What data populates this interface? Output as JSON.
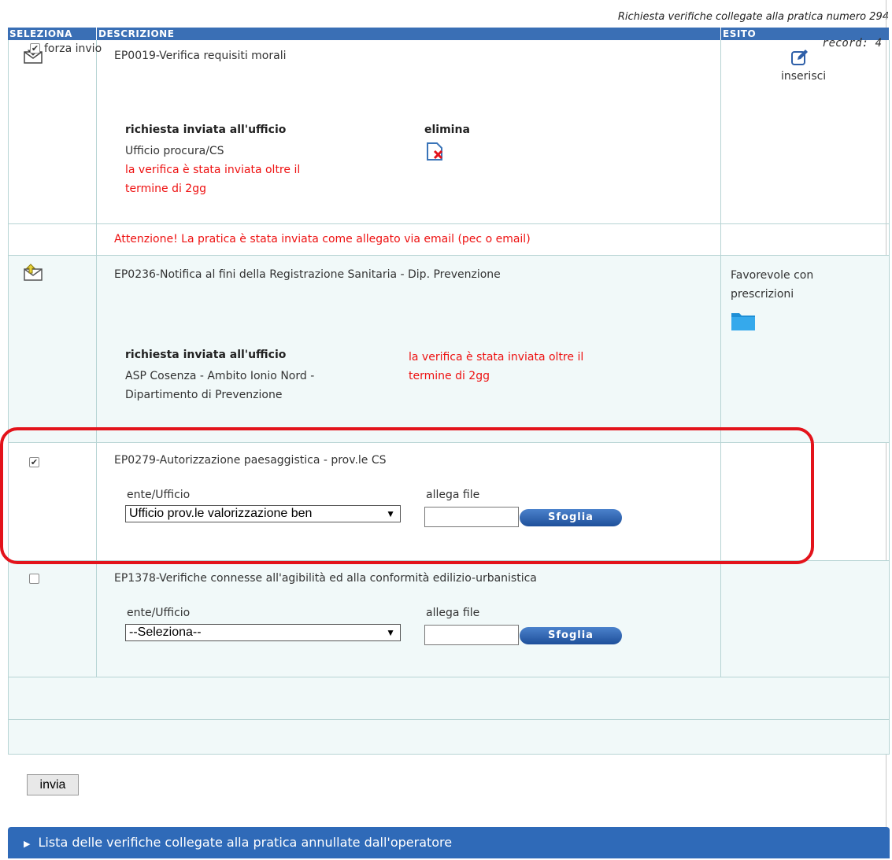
{
  "caption": "Richiesta verifiche collegate alla pratica numero 294",
  "header": {
    "col_select": "SELEZIONA",
    "col_desc": "DESCRIZIONE",
    "col_esito": "ESITO"
  },
  "row1": {
    "title": "EP0019-Verifica requisiti morali",
    "sent_label": "richiesta inviata all'ufficio",
    "office": "Ufficio procura/CS",
    "late_line1": "la verifica è stata inviata oltre il",
    "late_line2": "termine di 2gg",
    "delete_label": "elimina",
    "esito_action": "inserisci"
  },
  "notice": "Attenzione! La pratica è stata inviata come allegato via email (pec o email)",
  "row2": {
    "title": "EP0236-Notifica al fini della Registrazione Sanitaria - Dip. Prevenzione",
    "esito_line1": "Favorevole con",
    "esito_line2": "prescrizioni",
    "sent_label": "richiesta inviata all'ufficio",
    "office_line1": "ASP Cosenza - Ambito Ionio Nord -",
    "office_line2": "Dipartimento di Prevenzione",
    "late_line1": "la verifica è stata inviata oltre il",
    "late_line2": "termine di 2gg"
  },
  "row3": {
    "checked": true,
    "title": "EP0279-Autorizzazione paesaggistica - prov.le CS",
    "ente_label": "ente/Ufficio",
    "ente_value": "Ufficio prov.le valorizzazione ben",
    "file_label": "allega file",
    "browse": "Sfoglia"
  },
  "row4": {
    "checked": false,
    "title": "EP1378-Verifiche connesse all'agibilità ed alla conformità edilizio-urbanistica",
    "ente_label": "ente/Ufficio",
    "ente_value": "--Seleziona--",
    "file_label": "allega file",
    "browse": "Sfoglia"
  },
  "force": {
    "checked": true,
    "label": "forza invio"
  },
  "record_count": "record: 4",
  "submit": "invia",
  "accordion": "Lista delle verifiche collegate alla pratica annullate dall'operatore"
}
